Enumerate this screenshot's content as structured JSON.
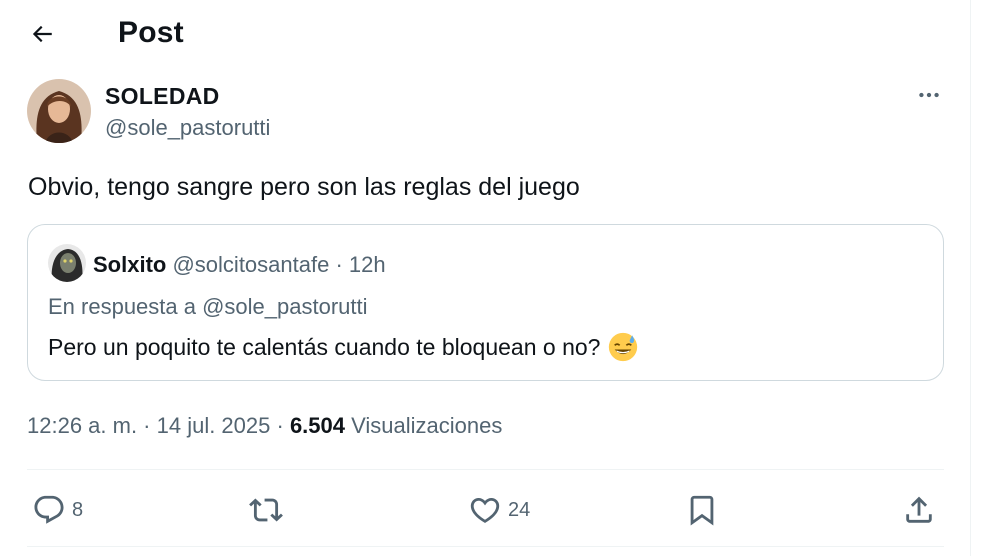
{
  "header": {
    "title": "Post",
    "back_icon": "arrow-left-icon"
  },
  "post": {
    "author_name": "SOLEDAD",
    "author_handle": "@sole_pastorutti",
    "text": "Obvio, tengo sangre pero son las reglas del juego",
    "quoted": {
      "author_name": "Solxito",
      "author_meta": "@solcitosantafe · 12h",
      "reply_context": "En respuesta a @sole_pastorutti",
      "text": "Pero un poquito te calentás cuando te bloquean o no?",
      "emoji": "grinning-face-with-sweat-icon"
    },
    "timestamp": "12:26 a. m. · 14 jul. 2025 · ",
    "views_count": "6.504",
    "views_label": " Visualizaciones"
  },
  "actions": {
    "reply_count": "8",
    "retweet_count": "",
    "like_count": "24"
  },
  "colors": {
    "text": "#0f1419",
    "secondary": "#536471",
    "border": "#cfd9de",
    "divider": "#eff3f4"
  }
}
